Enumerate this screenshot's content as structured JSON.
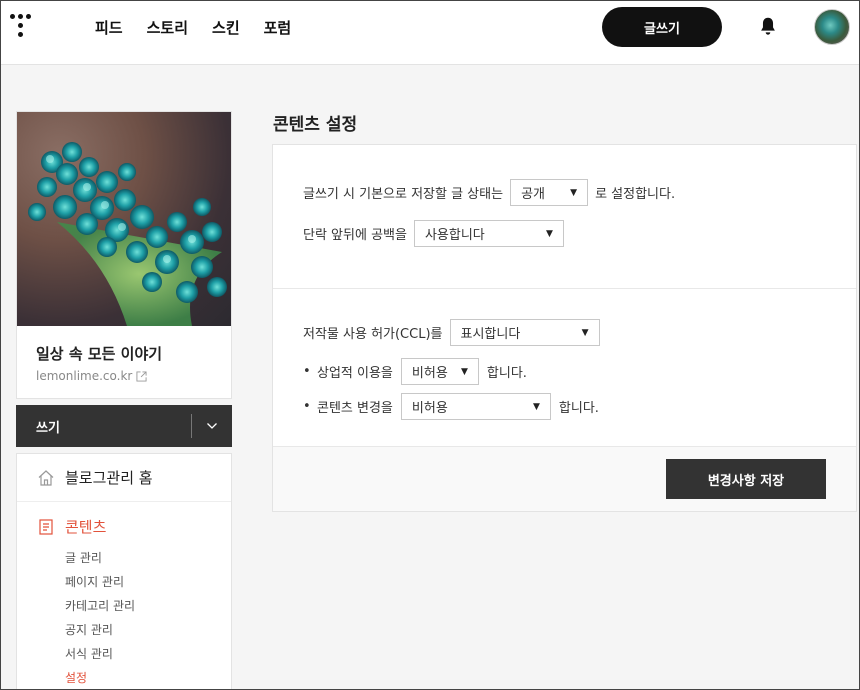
{
  "header": {
    "nav": [
      "피드",
      "스토리",
      "스킨",
      "포럼"
    ],
    "write_button": "글쓰기"
  },
  "sidebar": {
    "blog_title": "일상 속 모든 이야기",
    "blog_url": "lemonlime.co.kr",
    "write_label": "쓰기",
    "home_label": "블로그관리 홈",
    "section_label": "콘텐츠",
    "sub_items": [
      "글 관리",
      "페이지 관리",
      "카테고리 관리",
      "공지 관리",
      "서식 관리",
      "설정"
    ],
    "active_sub_item": "설정"
  },
  "main": {
    "title": "콘텐츠 설정",
    "default_status_prefix": "글쓰기 시 기본으로 저장할 글 상태는",
    "default_status_value": "공개",
    "default_status_suffix": "로 설정합니다.",
    "spacing_label": "단락 앞뒤에 공백을",
    "spacing_value": "사용합니다",
    "ccl_label": "저작물 사용 허가(CCL)를",
    "ccl_value": "표시합니다",
    "bullet": "•",
    "commercial_label": "상업적 이용을",
    "commercial_value": "비허용",
    "commercial_suffix": "합니다.",
    "modify_label": "콘텐츠 변경을",
    "modify_value": "비허용",
    "modify_suffix": "합니다.",
    "save_button": "변경사항 저장"
  },
  "colors": {
    "accent": "#e2523b",
    "dark": "#333333"
  },
  "icons": [
    "tistory-logo-icon",
    "bell-icon",
    "external-link-icon",
    "chevron-down-icon",
    "home-icon",
    "document-icon",
    "caret-down-icon"
  ]
}
